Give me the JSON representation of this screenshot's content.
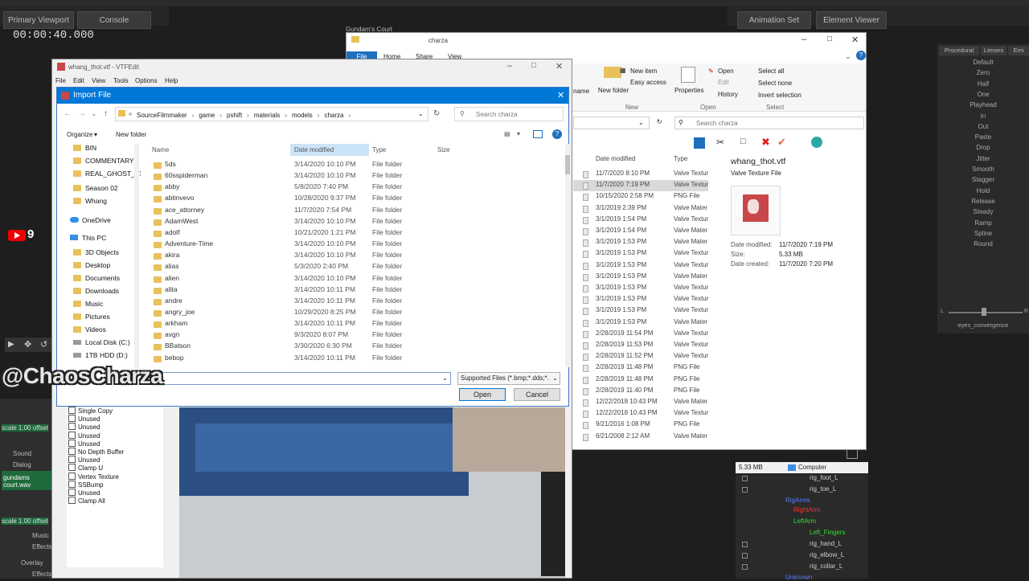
{
  "sfm": {
    "tabs": [
      "Primary Viewport",
      "Console"
    ],
    "timer": "00:00:40.000",
    "right_tabs": [
      "Animation Set Editor",
      "Element Viewer"
    ],
    "anim_tabs": [
      "Procedural",
      "Lenses",
      "Emi"
    ],
    "anim_items": [
      "Default",
      "Zero",
      "Half",
      "One",
      "Playhead",
      "In",
      "Out",
      "Paste",
      "Drop",
      "Jitter",
      "Smooth",
      "Stagger",
      "Hold",
      "Release",
      "Steady",
      "Ramp",
      "Spline",
      "Round"
    ],
    "slider_label": "eyes_convergence",
    "slider_l": "L",
    "slider_r": "R",
    "youtube_count": "9",
    "watermark": "@ChaosCharza",
    "timeline": [
      "scale 1.00 offset",
      "Sound",
      "Dialog",
      "gundams court.wav",
      "scale 1.00 offset",
      "Music",
      "Effects",
      "Overlay",
      "Effects"
    ],
    "tree": [
      {
        "label": "rig_foot_L",
        "color": "#cfcfcf"
      },
      {
        "label": "rig_toe_L",
        "color": "#cfcfcf"
      },
      {
        "label": "RigArms",
        "color": "#5a7cff"
      },
      {
        "label": "RightArm",
        "color": "#ff3030"
      },
      {
        "label": "LeftArm",
        "color": "#30e030"
      },
      {
        "label": "Left_Fingers",
        "color": "#30e030"
      },
      {
        "label": "rig_hand_L",
        "color": "#cfcfcf"
      },
      {
        "label": "rig_elbow_L",
        "color": "#cfcfcf"
      },
      {
        "label": "rig_collar_L",
        "color": "#cfcfcf"
      },
      {
        "label": "Unknown",
        "color": "#5a7cff"
      }
    ]
  },
  "explorer": {
    "window_label": "Gundam's Court",
    "title": "charza",
    "ribbon_tabs": [
      "File",
      "Home",
      "Share",
      "View"
    ],
    "buttons": {
      "new_item": "New item",
      "easy_access": "Easy access",
      "new_folder": "New folder",
      "name_frag": "name",
      "new_group": "New",
      "properties": "Properties",
      "open": "Open",
      "edit": "Edit",
      "history": "History",
      "open_group": "Open",
      "select_all": "Select all",
      "select_none": "Select none",
      "invert_selection": "Invert selection",
      "select_group": "Select"
    },
    "search_placeholder": "Search charza",
    "columns": [
      "Date modified",
      "Type"
    ],
    "rows": [
      {
        "date": "11/7/2020 8:10 PM",
        "type": "Valve Textur"
      },
      {
        "date": "11/7/2020 7:19 PM",
        "type": "Valve Textur"
      },
      {
        "date": "10/15/2020 2:58 PM",
        "type": "PNG File"
      },
      {
        "date": "3/1/2019 2:39 PM",
        "type": "Valve Mater"
      },
      {
        "date": "3/1/2019 1:54 PM",
        "type": "Valve Textur"
      },
      {
        "date": "3/1/2019 1:54 PM",
        "type": "Valve Mater"
      },
      {
        "date": "3/1/2019 1:53 PM",
        "type": "Valve Mater"
      },
      {
        "date": "3/1/2019 1:53 PM",
        "type": "Valve Textur"
      },
      {
        "date": "3/1/2019 1:53 PM",
        "type": "Valve Textur"
      },
      {
        "date": "3/1/2019 1:53 PM",
        "type": "Valve Mater"
      },
      {
        "date": "3/1/2019 1:53 PM",
        "type": "Valve Textur"
      },
      {
        "date": "3/1/2019 1:53 PM",
        "type": "Valve Textur"
      },
      {
        "date": "3/1/2019 1:53 PM",
        "type": "Valve Textur"
      },
      {
        "date": "3/1/2019 1:53 PM",
        "type": "Valve Mater"
      },
      {
        "date": "2/28/2019 11:54 PM",
        "type": "Valve Textur"
      },
      {
        "date": "2/28/2019 11:53 PM",
        "type": "Valve Textur"
      },
      {
        "date": "2/28/2019 11:52 PM",
        "type": "Valve Textur"
      },
      {
        "date": "2/28/2019 11:48 PM",
        "type": "PNG File"
      },
      {
        "date": "2/28/2019 11:48 PM",
        "type": "PNG File"
      },
      {
        "date": "2/28/2019 11:40 PM",
        "type": "PNG File"
      },
      {
        "date": "12/22/2018 10:43 PM",
        "type": "Valve Mater"
      },
      {
        "date": "12/22/2018 10:43 PM",
        "type": "Valve Textur"
      },
      {
        "date": "9/21/2016 1:08 PM",
        "type": "PNG File"
      },
      {
        "date": "6/21/2008 2:12 AM",
        "type": "Valve Mater"
      }
    ],
    "preview": {
      "filename": "whang_thot.vtf",
      "filetype": "Valve Texture File",
      "date_modified_label": "Date modified:",
      "date_modified": "11/7/2020 7:19 PM",
      "size_label": "Size:",
      "size": "5.33 MB",
      "date_created_label": "Date created:",
      "date_created": "11/7/2020 7:20 PM"
    },
    "status_size": "5.33 MB",
    "status_computer": "Computer"
  },
  "vtfedit": {
    "title": "whang_thot.vtf - VTFEdit",
    "menu": [
      "File",
      "Edit",
      "View",
      "Tools",
      "Options",
      "Help"
    ],
    "flags": [
      "Single Copy",
      "Unused",
      "Unused",
      "Unused",
      "Unused",
      "No Depth Buffer",
      "Unused",
      "Clamp U",
      "Vertex Texture",
      "SSBump",
      "Unused",
      "Clamp All"
    ]
  },
  "dialog": {
    "title": "Import File",
    "breadcrumb": [
      "SourceFilmmaker",
      "game",
      "pshift",
      "materials",
      "models",
      "charza"
    ],
    "search_placeholder": "Search charza",
    "organize": "Organize",
    "new_folder": "New folder",
    "sidebar": [
      "BIN",
      "COMMENTARY_",
      "REAL_GHOST_V3",
      "Season 02",
      "Whang",
      "OneDrive",
      "This PC",
      "3D Objects",
      "Desktop",
      "Documents",
      "Downloads",
      "Music",
      "Pictures",
      "Videos",
      "Local Disk (C:)",
      "1TB HDD (D:)"
    ],
    "columns": {
      "name": "Name",
      "date": "Date modified",
      "type": "Type",
      "size": "Size"
    },
    "files": [
      {
        "name": "5ds",
        "date": "3/14/2020 10:10 PM",
        "type": "File folder"
      },
      {
        "name": "60sspiderman",
        "date": "3/14/2020 10:10 PM",
        "type": "File folder"
      },
      {
        "name": "abby",
        "date": "5/8/2020 7:40 PM",
        "type": "File folder"
      },
      {
        "name": "abtinvevo",
        "date": "10/28/2020 9:37 PM",
        "type": "File folder"
      },
      {
        "name": "ace_attorney",
        "date": "11/7/2020 7:54 PM",
        "type": "File folder"
      },
      {
        "name": "AdamWest",
        "date": "3/14/2020 10:10 PM",
        "type": "File folder"
      },
      {
        "name": "adolf",
        "date": "10/21/2020 1:21 PM",
        "type": "File folder"
      },
      {
        "name": "Adventure-Time",
        "date": "3/14/2020 10:10 PM",
        "type": "File folder"
      },
      {
        "name": "akira",
        "date": "3/14/2020 10:10 PM",
        "type": "File folder"
      },
      {
        "name": "alias",
        "date": "5/3/2020 2:40 PM",
        "type": "File folder"
      },
      {
        "name": "alien",
        "date": "3/14/2020 10:10 PM",
        "type": "File folder"
      },
      {
        "name": "alita",
        "date": "3/14/2020 10:11 PM",
        "type": "File folder"
      },
      {
        "name": "andre",
        "date": "3/14/2020 10:11 PM",
        "type": "File folder"
      },
      {
        "name": "angry_joe",
        "date": "10/29/2020 8:25 PM",
        "type": "File folder"
      },
      {
        "name": "arkham",
        "date": "3/14/2020 10:11 PM",
        "type": "File folder"
      },
      {
        "name": "avgn",
        "date": "9/3/2020 8:07 PM",
        "type": "File folder"
      },
      {
        "name": "BBatson",
        "date": "3/30/2020 6:30 PM",
        "type": "File folder"
      },
      {
        "name": "bebop",
        "date": "3/14/2020 10:11 PM",
        "type": "File folder"
      }
    ],
    "filename_value": "",
    "file_type": "Supported Files (*.bmp;*.dds;*.",
    "open_button": "Open",
    "cancel_button": "Cancel"
  }
}
